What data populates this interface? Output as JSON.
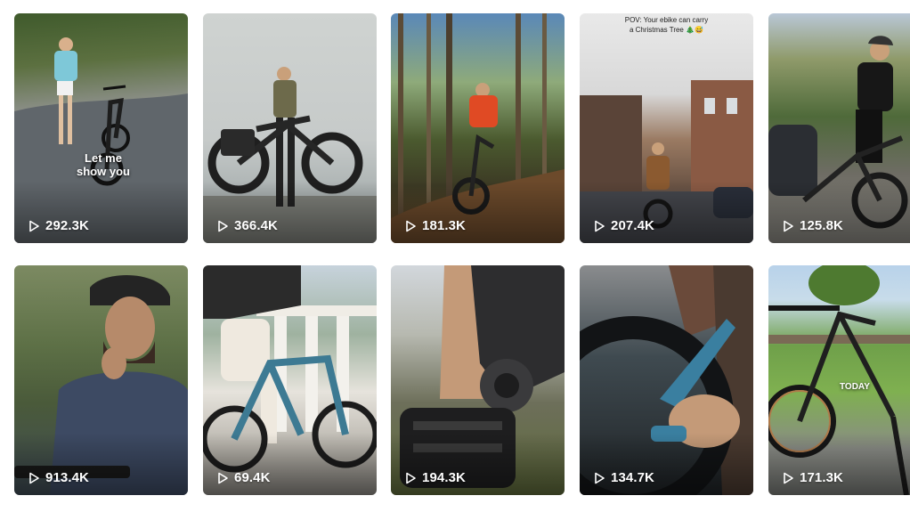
{
  "videos": [
    {
      "views": "292.3K",
      "overlay": "Let me\nshow you"
    },
    {
      "views": "366.4K"
    },
    {
      "views": "181.3K"
    },
    {
      "views": "207.4K",
      "caption": "POV: Your ebike can carry\na Christmas Tree 🎄😅"
    },
    {
      "views": "125.8K"
    },
    {
      "views": "913.4K"
    },
    {
      "views": "69.4K"
    },
    {
      "views": "194.3K"
    },
    {
      "views": "134.7K"
    },
    {
      "views": "171.3K",
      "overlay": "TODAY"
    }
  ],
  "icons": {
    "views": "play-outline-icon"
  }
}
